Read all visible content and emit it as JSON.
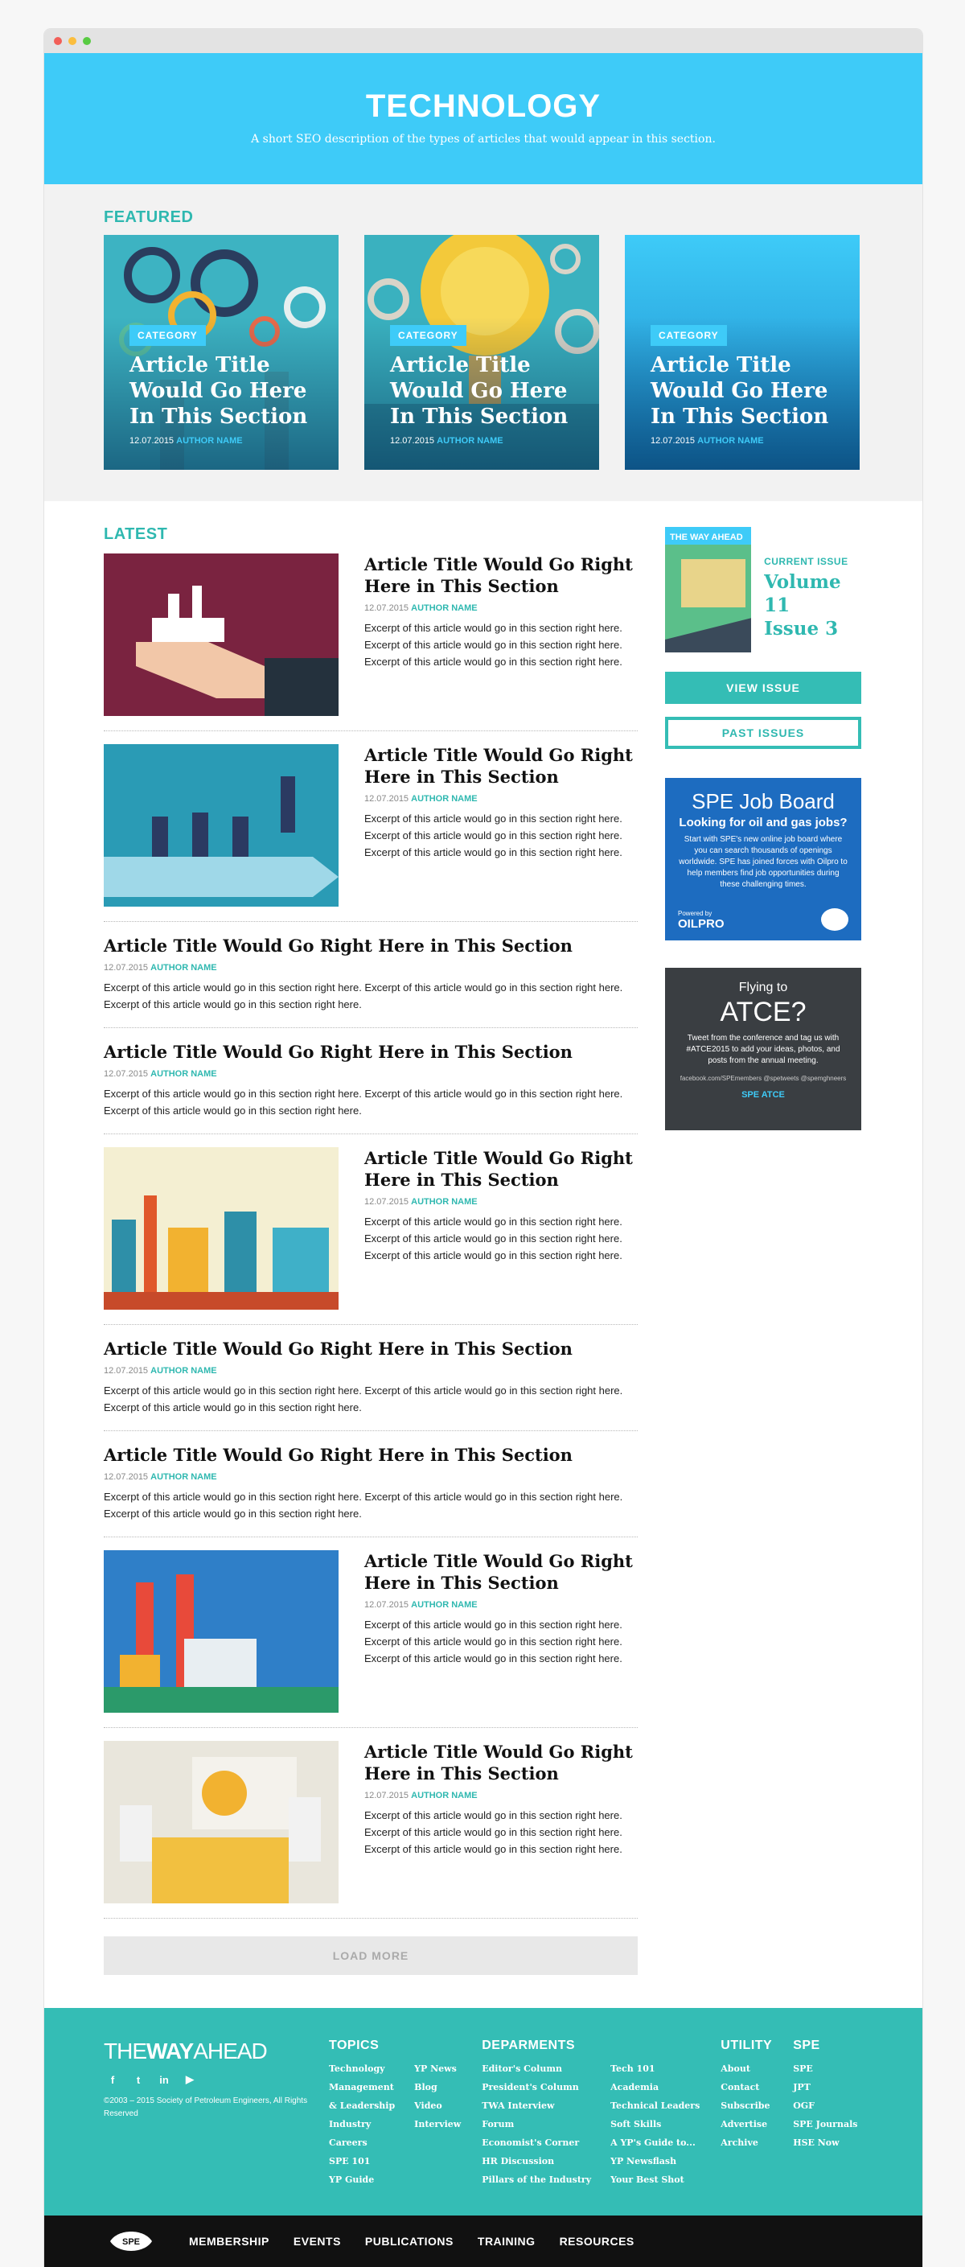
{
  "hero": {
    "title": "TECHNOLOGY",
    "description": "A short SEO description of the types of articles that would appear in this section."
  },
  "featured": {
    "label": "FEATURED",
    "cards": [
      {
        "category": "CATEGORY",
        "title": "Article Title Would Go Here In This Section",
        "date": "12.07.2015",
        "author": "AUTHOR NAME"
      },
      {
        "category": "CATEGORY",
        "title": "Article Title Would Go Here In This Section",
        "date": "12.07.2015",
        "author": "AUTHOR NAME"
      },
      {
        "category": "CATEGORY",
        "title": "Article Title Would Go Here In This Section",
        "date": "12.07.2015",
        "author": "AUTHOR NAME"
      }
    ]
  },
  "latest": {
    "label": "LATEST",
    "articles": [
      {
        "title": "Article Title Would Go Right Here in This Section",
        "date": "12.07.2015",
        "author": "AUTHOR NAME",
        "excerpt": "Excerpt of this article would go in this section right here. Excerpt of this article would go in this section right here. Excerpt of this article would go in this section right here."
      },
      {
        "title": "Article Title Would Go Right Here in This Section",
        "date": "12.07.2015",
        "author": "AUTHOR NAME",
        "excerpt": "Excerpt of this article would go in this section right here. Excerpt of this article would go in this section right here. Excerpt of this article would go in this section right here."
      },
      {
        "title": "Article Title Would Go Right Here in This Section",
        "date": "12.07.2015",
        "author": "AUTHOR NAME",
        "excerpt": "Excerpt of this article would go in this section right here. Excerpt of this article would go in this section right here. Excerpt of this article would go in this section right here."
      },
      {
        "title": "Article Title Would Go Right Here in This Section",
        "date": "12.07.2015",
        "author": "AUTHOR NAME",
        "excerpt": "Excerpt of this article would go in this section right here. Excerpt of this article would go in this section right here. Excerpt of this article would go in this section right here."
      },
      {
        "title": "Article Title Would Go Right Here in This Section",
        "date": "12.07.2015",
        "author": "AUTHOR NAME",
        "excerpt": "Excerpt of this article would go in this section right here. Excerpt of this article would go in this section right here. Excerpt of this article would go in this section right here."
      },
      {
        "title": "Article Title Would Go Right Here in This Section",
        "date": "12.07.2015",
        "author": "AUTHOR NAME",
        "excerpt": "Excerpt of this article would go in this section right here. Excerpt of this article would go in this section right here. Excerpt of this article would go in this section right here."
      },
      {
        "title": "Article Title Would Go Right Here in This Section",
        "date": "12.07.2015",
        "author": "AUTHOR NAME",
        "excerpt": "Excerpt of this article would go in this section right here. Excerpt of this article would go in this section right here. Excerpt of this article would go in this section right here."
      },
      {
        "title": "Article Title Would Go Right Here in This Section",
        "date": "12.07.2015",
        "author": "AUTHOR NAME",
        "excerpt": "Excerpt of this article would go in this section right here. Excerpt of this article would go in this section right here. Excerpt of this article would go in this section right here."
      },
      {
        "title": "Article Title Would Go Right Here in This Section",
        "date": "12.07.2015",
        "author": "AUTHOR NAME",
        "excerpt": "Excerpt of this article would go in this section right here. Excerpt of this article would go in this section right here. Excerpt of this article would go in this section right here."
      }
    ],
    "load_more": "LOAD MORE"
  },
  "sidebar": {
    "cover_title": "THE WAY AHEAD",
    "current_issue_label": "CURRENT ISSUE",
    "volume": "Volume 11",
    "issue": "Issue 3",
    "view_issue": "VIEW ISSUE",
    "past_issues": "PAST ISSUES",
    "job_ad": {
      "title": "SPE Job Board",
      "subtitle": "Looking for oil and gas jobs?",
      "body": "Start with SPE's new online job board where you can search thousands of openings worldwide. SPE has joined forces with Oilpro to help members find job opportunities during these challenging times.",
      "powered": "Powered by",
      "partner": "OILPRO"
    },
    "atce_ad": {
      "line1": "Flying to",
      "line2": "ATCE?",
      "body": "Tweet from the conference and tag us with #ATCE2015 to add your ideas, photos, and posts from the annual meeting.",
      "handles": "facebook.com/SPEmembers  @spetweets  @spemghneers",
      "brand": "SPE ATCE"
    }
  },
  "footer": {
    "logo_thin": "THE",
    "logo_bold": "WAY",
    "logo_end": "AHEAD",
    "copyright": "©2003 – 2015 Society of Petroleum Engineers, All Rights Reserved",
    "columns": [
      {
        "heading": "TOPICS",
        "lists": [
          [
            "Technology",
            "Management",
            "& Leadership",
            "Industry",
            "Careers",
            "SPE 101",
            "YP Guide"
          ],
          [
            "YP News",
            "Blog",
            "Video",
            "Interview"
          ]
        ]
      },
      {
        "heading": "DEPARMENTS",
        "lists": [
          [
            "Editor's Column",
            "President's Column",
            "TWA Interview",
            "Forum",
            "Economist's Corner",
            "HR Discussion",
            "Pillars of the Industry"
          ],
          [
            "Tech 101",
            "Academia",
            "Technical Leaders",
            "Soft Skills",
            "A YP's Guide to...",
            "YP Newsflash",
            "Your Best Shot"
          ]
        ]
      },
      {
        "heading": "UTILITY",
        "lists": [
          [
            "About",
            "Contact",
            "Subscribe",
            "Advertise",
            "Archive"
          ]
        ]
      },
      {
        "heading": "SPE",
        "lists": [
          [
            "SPE",
            "JPT",
            "OGF",
            "SPE Journals",
            "HSE Now"
          ]
        ]
      }
    ]
  },
  "navbar": {
    "logo": "SPE",
    "items": [
      "MEMBERSHIP",
      "EVENTS",
      "PUBLICATIONS",
      "TRAINING",
      "RESOURCES"
    ]
  },
  "colors": {
    "accent": "#3ecbf8",
    "teal": "#34bdb5",
    "dark": "#111111"
  }
}
